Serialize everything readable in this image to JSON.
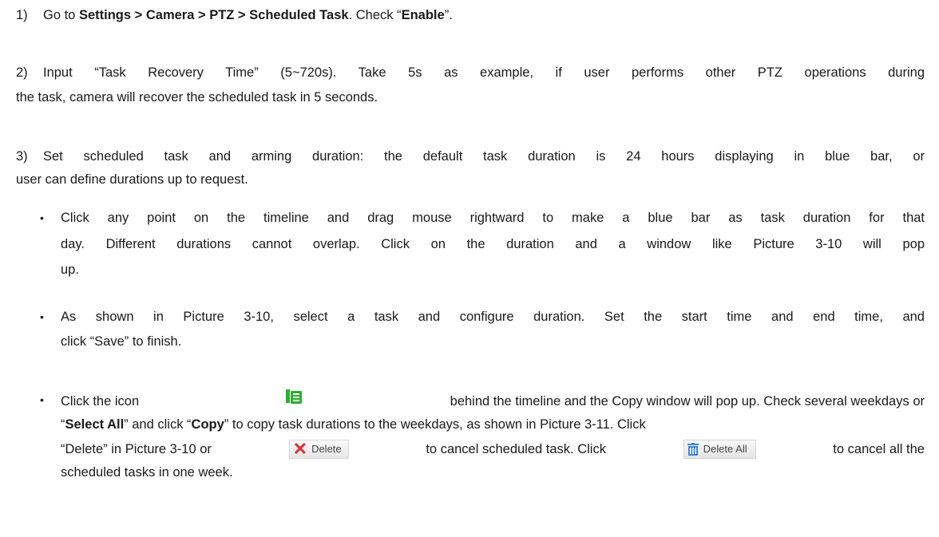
{
  "step1": {
    "num": "1)",
    "pre": "Go to ",
    "path": "Settings > Camera > PTZ > Scheduled Task",
    "mid": ". Check “",
    "enable": "Enable",
    "end": "”."
  },
  "step2": {
    "num": "2)",
    "line1": "Input “Task Recovery Time” (5~720s). Take 5s as example, if user performs other PTZ operations during",
    "line2": "the task, camera will recover the scheduled task in 5 seconds."
  },
  "step3": {
    "num": "3)",
    "line1": "Set scheduled task and arming duration: the default task duration is 24 hours displaying in blue bar, or",
    "line2": "user can define durations up to request."
  },
  "bullet_symbol": "•",
  "bullet1": {
    "line1": "Click any point on the timeline and drag mouse rightward to make a blue bar as task duration for that",
    "line2": "day. Different durations cannot overlap. Click on the duration and a window like Picture 3-10 will pop",
    "line3": "up."
  },
  "bullet2": {
    "line1": "As shown in Picture 3-10, select a task and configure duration. Set the start time and end time, and",
    "line2": "click “Save” to finish."
  },
  "bullet3": {
    "l1_a": "Click the icon",
    "l1_b": "behind the timeline and the Copy window will pop up. Check several weekdays or",
    "l2_q1": "“",
    "l2_selectall": "Select All",
    "l2_a": "” and click “",
    "l2_copy": "Copy",
    "l2_b": "” to copy task durations to the weekdays, as shown in Picture 3-11. Click",
    "l3_a": "“Delete” in Picture 3-10 or",
    "l3_b": "to cancel scheduled task. Click",
    "l3_c": "to cancel all the",
    "line4": "scheduled tasks in one week."
  },
  "delete_button": {
    "icon": "✕",
    "label": "Delete"
  },
  "delete_all_button": {
    "label": "Delete All"
  },
  "colors": {
    "copy_icon": "#2bb12b",
    "delete_x": "#e22d2d",
    "trash_icon": "#3a86d6"
  }
}
